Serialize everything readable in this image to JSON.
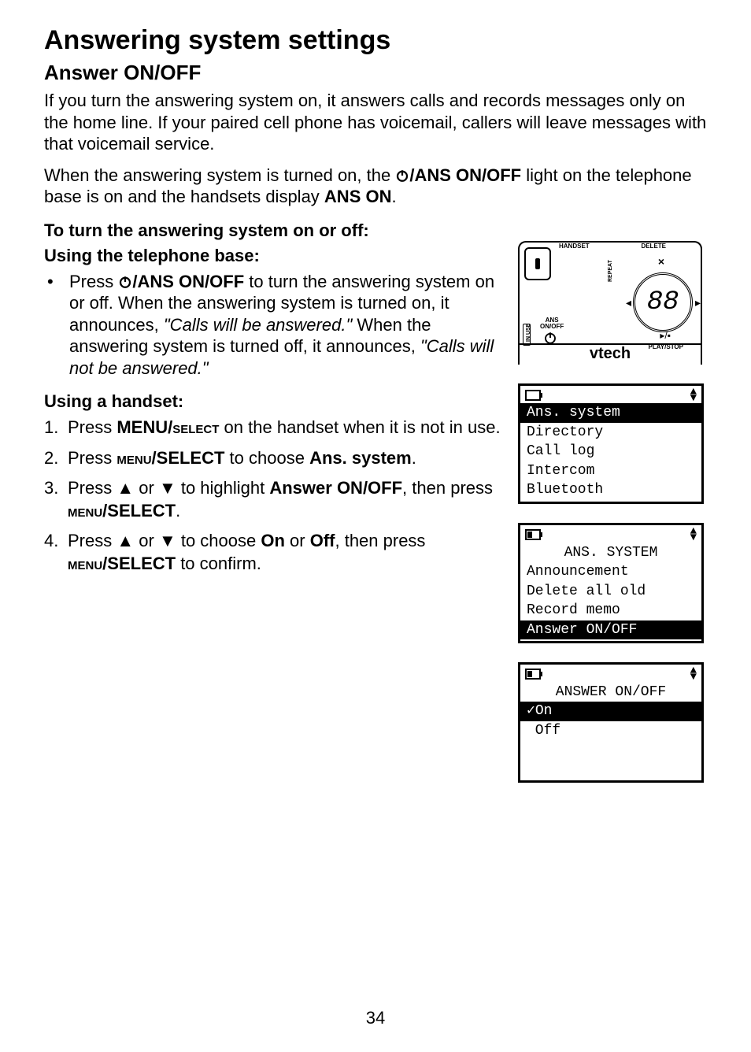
{
  "page": {
    "title": "Answering system settings",
    "subtitle": "Answer ON/OFF",
    "paragraph1": "If you turn the answering system on, it answers calls and records messages only on the home line. If your paired cell phone has voicemail, callers will leave messages with that voicemail service.",
    "para2_a": "When the answering system is turned on, the ",
    "para2_b": "/ANS ON/OFF",
    "para2_c": " light on the telephone base is on and the handsets display ",
    "para2_d": "ANS ON",
    "para2_e": ".",
    "heading_turn": "To turn the answering system on or off:",
    "heading_base": "Using the telephone base:",
    "bullet1_a": "Press ",
    "bullet1_b": "/ANS ON/OFF",
    "bullet1_c": " to turn the answering system on or off. When the answering system is turned on, it announces, ",
    "bullet1_d": "\"Calls will be answered.\"",
    "bullet1_e": "  When the answering system is turned off, it announces, ",
    "bullet1_f": "\"Calls will not be answered.\"",
    "heading_handset": "Using a handset:",
    "step1_a": "Press ",
    "step1_b": "MENU/",
    "step1_c": "select",
    "step1_d": " on the handset when it is not in use.",
    "step2_a": "Press ",
    "step2_b": "menu",
    "step2_c": "/SELECT",
    "step2_d": " to choose ",
    "step2_e": "Ans. system",
    "step2_f": ".",
    "step3_a": "Press ",
    "step3_b": " or ",
    "step3_c": " to highlight ",
    "step3_d": "Answer ON/OFF",
    "step3_e": ", then press ",
    "step3_f": "menu",
    "step3_g": "/SELECT",
    "step3_h": ".",
    "step4_a": "Press ",
    "step4_b": " or ",
    "step4_c": " to choose ",
    "step4_d": "On",
    "step4_e": " or ",
    "step4_f": "Off",
    "step4_g": ", then press ",
    "step4_h": "menu",
    "step4_i": "/SELECT",
    "step4_j": " to confirm.",
    "page_number": "34"
  },
  "base_device": {
    "handset_label": "HANDSET",
    "delete_label": "DELETE",
    "x_icon": "×",
    "counter": "88",
    "repeat_label": "REPEAT",
    "left_arrow": "◂",
    "right_arrow": "▸",
    "ans_label_line1": "ANS",
    "ans_label_line2": "ON/OFF",
    "inuse_label": "IN USE",
    "playstop_label": "PLAY/STOP",
    "playstop_icon": "▸/▪",
    "brand": "vtech"
  },
  "lcd1": {
    "items": [
      "Ans. system",
      "Directory",
      "Call log",
      "Intercom",
      "Bluetooth"
    ],
    "selected_index": 0
  },
  "lcd2": {
    "title": "ANS. SYSTEM",
    "items": [
      "Announcement",
      "Delete all old",
      "Record memo",
      "Answer ON/OFF"
    ],
    "selected_index": 3
  },
  "lcd3": {
    "title": "ANSWER ON/OFF",
    "items": [
      "✓On",
      " Off"
    ],
    "selected_index": 0
  }
}
